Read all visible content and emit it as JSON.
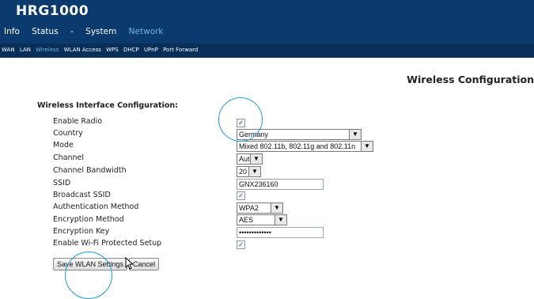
{
  "header": {
    "brand": "HRG1000",
    "nav": [
      "Info",
      "Status",
      "-",
      "System",
      "Network"
    ],
    "nav_active_index": 4
  },
  "subnav": {
    "items": [
      "WAN",
      "LAN",
      "Wireless",
      "WLAN Access",
      "WPS",
      "DHCP",
      "UPnP",
      "Port Forward"
    ],
    "active_index": 2
  },
  "page_title": "Wireless Configuration",
  "section_title": "Wireless Interface Configuration:",
  "fields": {
    "enable_radio": {
      "label": "Enable Radio",
      "checked": "✓"
    },
    "country": {
      "label": "Country",
      "value": "Germany"
    },
    "mode": {
      "label": "Mode",
      "value": "Mixed 802.11b, 802.11g and 802.11n"
    },
    "channel": {
      "label": "Channel",
      "value": "Auto"
    },
    "channel_bandwidth": {
      "label": "Channel Bandwidth",
      "value": "20"
    },
    "ssid": {
      "label": "SSID",
      "value": "GNX236160"
    },
    "broadcast_ssid": {
      "label": "Broadcast SSID",
      "checked": "✓"
    },
    "auth_method": {
      "label": "Authentication Method",
      "value": "WPA2"
    },
    "enc_method": {
      "label": "Encryption Method",
      "value": "AES"
    },
    "enc_key": {
      "label": "Encryption Key",
      "value": "•••••••••••••"
    },
    "wps": {
      "label": "Enable Wi-Fi Protected Setup",
      "checked": "✓"
    }
  },
  "buttons": {
    "save": "Save WLAN Settings",
    "cancel": "Cancel"
  },
  "colors": {
    "header_bg": "#0b3a6e",
    "subnav_bg": "#082f5a",
    "active_link": "#6fb4e4",
    "highlight_circle": "#1e9ad8"
  }
}
